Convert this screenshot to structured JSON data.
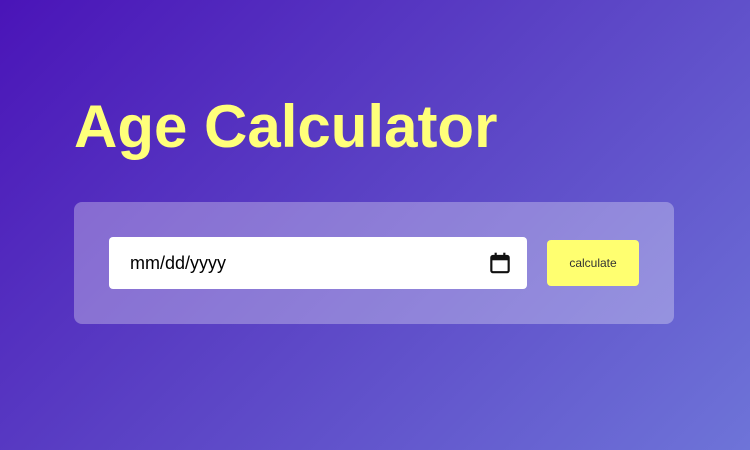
{
  "title": "Age Calculator",
  "colors": {
    "title": "#ffff7a",
    "button_bg": "#ffff70",
    "bg_start": "#4a14b8",
    "bg_end": "#6e74d8"
  },
  "form": {
    "date_input": {
      "placeholder": "mm/dd/yyyy",
      "value": "",
      "icon": "calendar-icon"
    },
    "calculate_button": {
      "label": "calculate"
    }
  }
}
